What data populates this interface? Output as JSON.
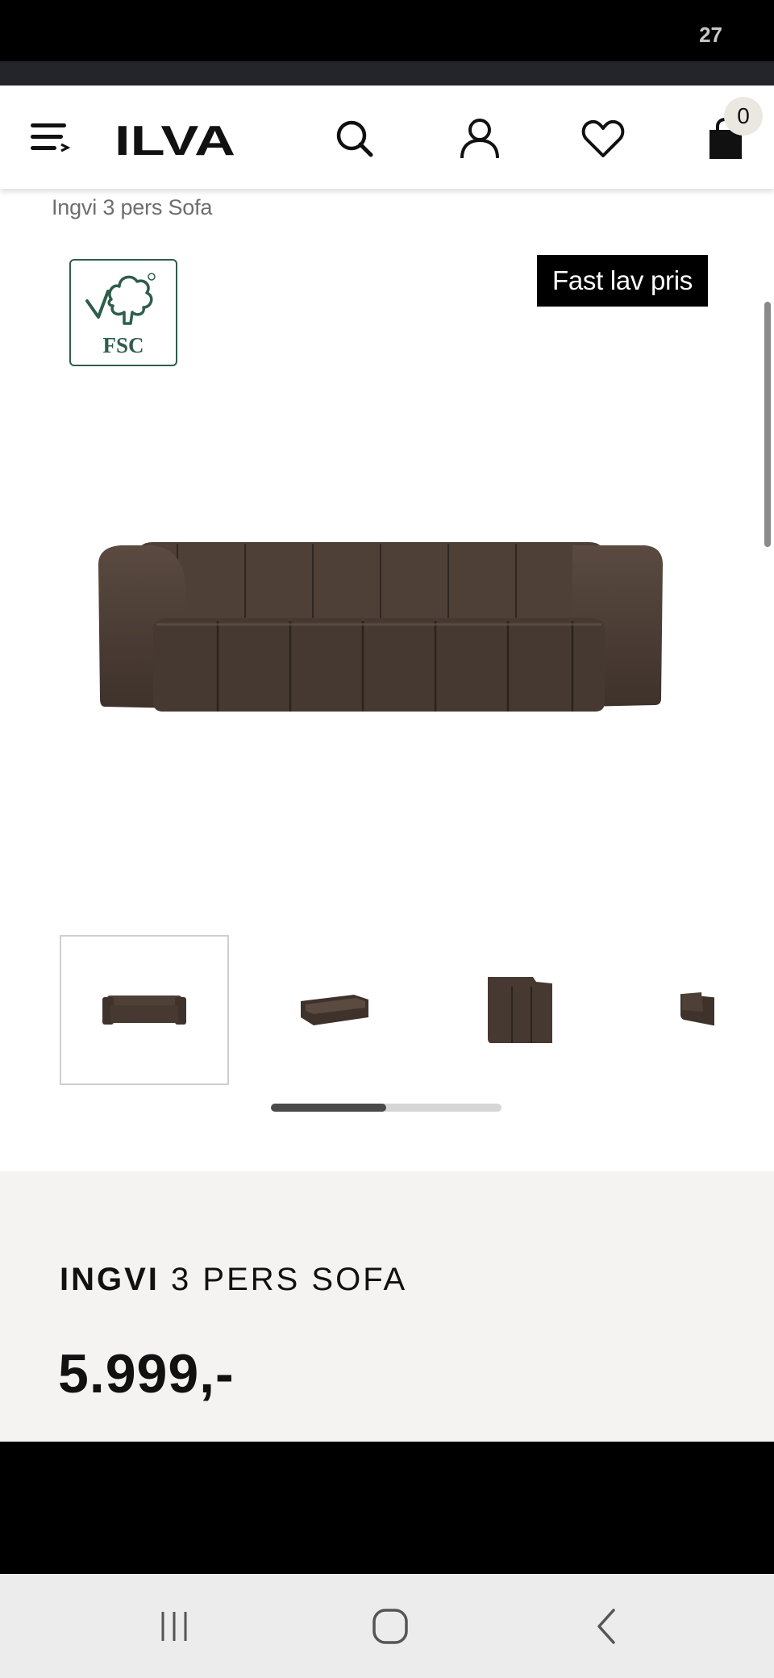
{
  "status_bar": {
    "time": "27"
  },
  "header": {
    "logo_text": "ILVA",
    "cart_count": "0",
    "icons": [
      "menu-icon",
      "search-icon",
      "account-icon",
      "heart-icon",
      "cart-icon"
    ]
  },
  "breadcrumb": "Ingvi 3 pers Sofa",
  "badges": {
    "fsc_label": "FSC",
    "price_tag": "Fast lav pris"
  },
  "gallery": {
    "thumbnails": [
      {
        "view": "front",
        "selected": true
      },
      {
        "view": "angle",
        "selected": false
      },
      {
        "view": "side",
        "selected": false
      },
      {
        "view": "back",
        "selected": false
      }
    ],
    "scroll_progress": 0.5
  },
  "product": {
    "brand": "INGVI",
    "name": "3 PERS SOFA",
    "price": "5.999,-"
  },
  "colors": {
    "sofa": "#4a3c33",
    "fsc_green": "#2f5d4c",
    "panel_bg": "#f4f3f2"
  },
  "nav_bar": {
    "buttons": [
      "recents-icon",
      "home-icon",
      "back-icon"
    ]
  }
}
